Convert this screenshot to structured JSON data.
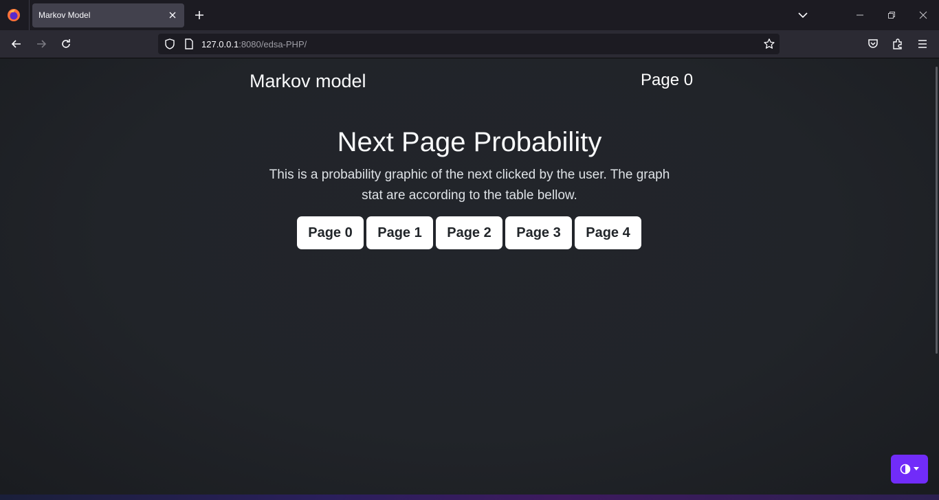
{
  "browser": {
    "tab_title": "Markov Model",
    "url_host": "127.0.0.1",
    "url_rest": ":8080/edsa-PHP/"
  },
  "icons": {
    "app": "firefox-logo-icon",
    "tab_close": "close-icon",
    "new_tab": "plus-icon",
    "tab_list": "chevron-down-icon",
    "minimize": "minimize-icon",
    "restore": "restore-icon",
    "close_window": "close-icon",
    "back": "arrow-left-icon",
    "forward": "arrow-right-icon",
    "reload": "reload-icon",
    "tracking_protection": "shield-icon",
    "page_info": "document-icon",
    "bookmark": "star-icon",
    "pocket": "pocket-icon",
    "extensions": "puzzle-icon",
    "menu": "hamburger-icon",
    "theme_toggle": "contrast-icon"
  },
  "page": {
    "brand": "Markov model",
    "current_page": "Page 0",
    "headline": "Next Page Probability",
    "lead": "This is a probability graphic of the next clicked by the user. The graph stat are according to the table bellow.",
    "buttons": [
      "Page 0",
      "Page 1",
      "Page 2",
      "Page 3",
      "Page 4"
    ]
  },
  "colors": {
    "accent": "#712cf9",
    "page_bg": "#212529",
    "button_bg": "#ffffff"
  }
}
